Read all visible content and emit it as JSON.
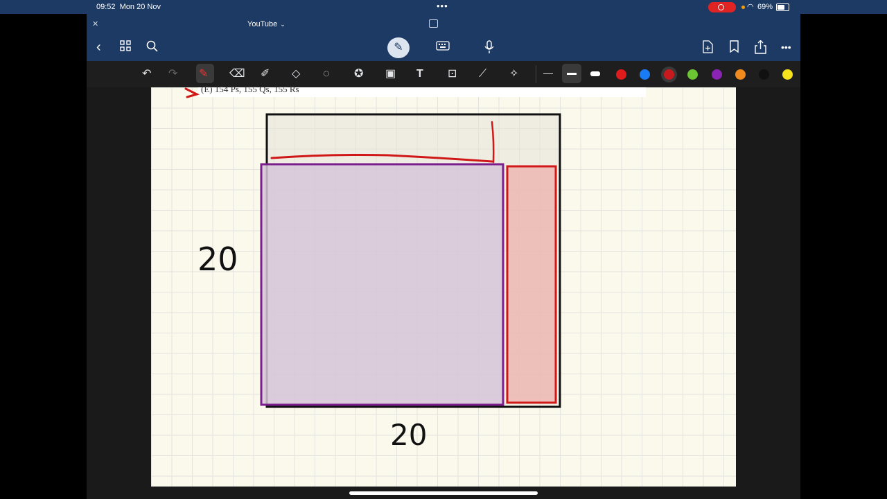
{
  "status_bar": {
    "time": "09:52",
    "date": "Mon 20 Nov",
    "battery": "69%"
  },
  "window": {
    "title": "YouTube"
  },
  "icons": {
    "close": "close-icon",
    "back": "chevron-left-icon",
    "grid": "grid-icon",
    "search": "search-icon",
    "pen": "pen-icon",
    "keyboard": "keyboard-icon",
    "mic": "microphone-icon",
    "add_page": "add-page-icon",
    "bookmark": "bookmark-icon",
    "share": "share-icon",
    "more": "more-icon"
  },
  "tools": [
    {
      "name": "undo-icon",
      "glyph": "↶"
    },
    {
      "name": "redo-icon",
      "glyph": "↷"
    },
    {
      "name": "pen-tool-icon",
      "glyph": "✎"
    },
    {
      "name": "eraser-icon",
      "glyph": "⌫"
    },
    {
      "name": "highlighter-icon",
      "glyph": "✐"
    },
    {
      "name": "shape-icon",
      "glyph": "◇"
    },
    {
      "name": "lasso-icon",
      "glyph": "◌"
    },
    {
      "name": "sticker-icon",
      "glyph": "✪"
    },
    {
      "name": "image-icon",
      "glyph": "▣"
    },
    {
      "name": "text-icon",
      "glyph": "T"
    },
    {
      "name": "camera-icon",
      "glyph": "⊡"
    },
    {
      "name": "ruler-icon",
      "glyph": "⟋"
    },
    {
      "name": "laser-icon",
      "glyph": "✧"
    }
  ],
  "colors": [
    "#e01b1b",
    "#1a7cf5",
    "#c8191e",
    "#6cc532",
    "#8a24b5",
    "#f28b1e",
    "#111111",
    "#f7e21e"
  ],
  "document": {
    "clipped_line": "(E) 154 Ps, 155 Qs, 155 Rs",
    "left_label": "20",
    "bottom_label": "20"
  }
}
